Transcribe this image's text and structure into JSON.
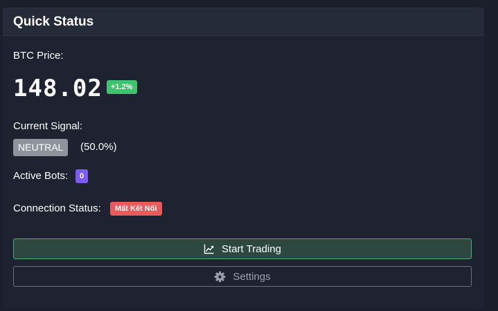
{
  "card": {
    "title": "Quick Status"
  },
  "price": {
    "label": "BTC Price:",
    "value": "148.02",
    "change": "+1.2%"
  },
  "signal": {
    "label": "Current Signal:",
    "value": "NEUTRAL",
    "confidence": "(50.0%)"
  },
  "bots": {
    "label": "Active Bots:",
    "count": "0"
  },
  "connection": {
    "label": "Connection Status:",
    "status": "Mất Kết Nối"
  },
  "actions": {
    "start_label": "Start Trading",
    "start_icon": "chart-line-icon",
    "settings_label": "Settings",
    "settings_icon": "gear-icon"
  },
  "colors": {
    "positive": "#3ec46d",
    "neutral": "#8f939b",
    "bots": "#7c5cf6",
    "error": "#ea5a5a"
  }
}
